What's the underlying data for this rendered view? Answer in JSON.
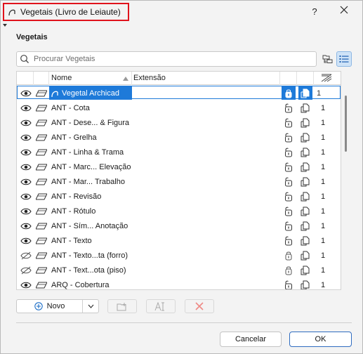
{
  "window": {
    "title": "Vegetais (Livro de Leiaute)",
    "help_label": "?"
  },
  "section_title": "Vegetais",
  "search": {
    "placeholder": "Procurar Vegetais",
    "value": ""
  },
  "table": {
    "columns": {
      "name": "Nome",
      "extension": "Extensão"
    },
    "rows": [
      {
        "name": "Vegetal Archicad",
        "visible": true,
        "locked": true,
        "count": "1",
        "selected": true
      },
      {
        "name": "ANT - Cota",
        "visible": true,
        "locked": false,
        "count": "1"
      },
      {
        "name": "ANT - Dese... & Figura",
        "visible": true,
        "locked": false,
        "count": "1"
      },
      {
        "name": "ANT - Grelha",
        "visible": true,
        "locked": false,
        "count": "1"
      },
      {
        "name": "ANT - Linha & Trama",
        "visible": true,
        "locked": false,
        "count": "1"
      },
      {
        "name": "ANT - Marc... Elevação",
        "visible": true,
        "locked": false,
        "count": "1"
      },
      {
        "name": "ANT - Mar... Trabalho",
        "visible": true,
        "locked": false,
        "count": "1"
      },
      {
        "name": "ANT - Revisão",
        "visible": true,
        "locked": false,
        "count": "1"
      },
      {
        "name": "ANT - Rótulo",
        "visible": true,
        "locked": false,
        "count": "1"
      },
      {
        "name": "ANT - Sím... Anotação",
        "visible": true,
        "locked": false,
        "count": "1"
      },
      {
        "name": "ANT - Texto",
        "visible": true,
        "locked": false,
        "count": "1"
      },
      {
        "name": "ANT - Texto...ta (forro)",
        "visible": false,
        "locked": true,
        "count": "1"
      },
      {
        "name": "ANT - Text...ota (piso)",
        "visible": false,
        "locked": true,
        "count": "1"
      },
      {
        "name": "ARQ - Cobertura",
        "visible": true,
        "locked": false,
        "count": "1"
      }
    ]
  },
  "toolbar": {
    "new_label": "Novo"
  },
  "footer": {
    "cancel_label": "Cancelar",
    "ok_label": "OK"
  },
  "colors": {
    "accent": "#1e7ad9",
    "title_highlight": "#e0131c",
    "delete": "#e53935"
  }
}
